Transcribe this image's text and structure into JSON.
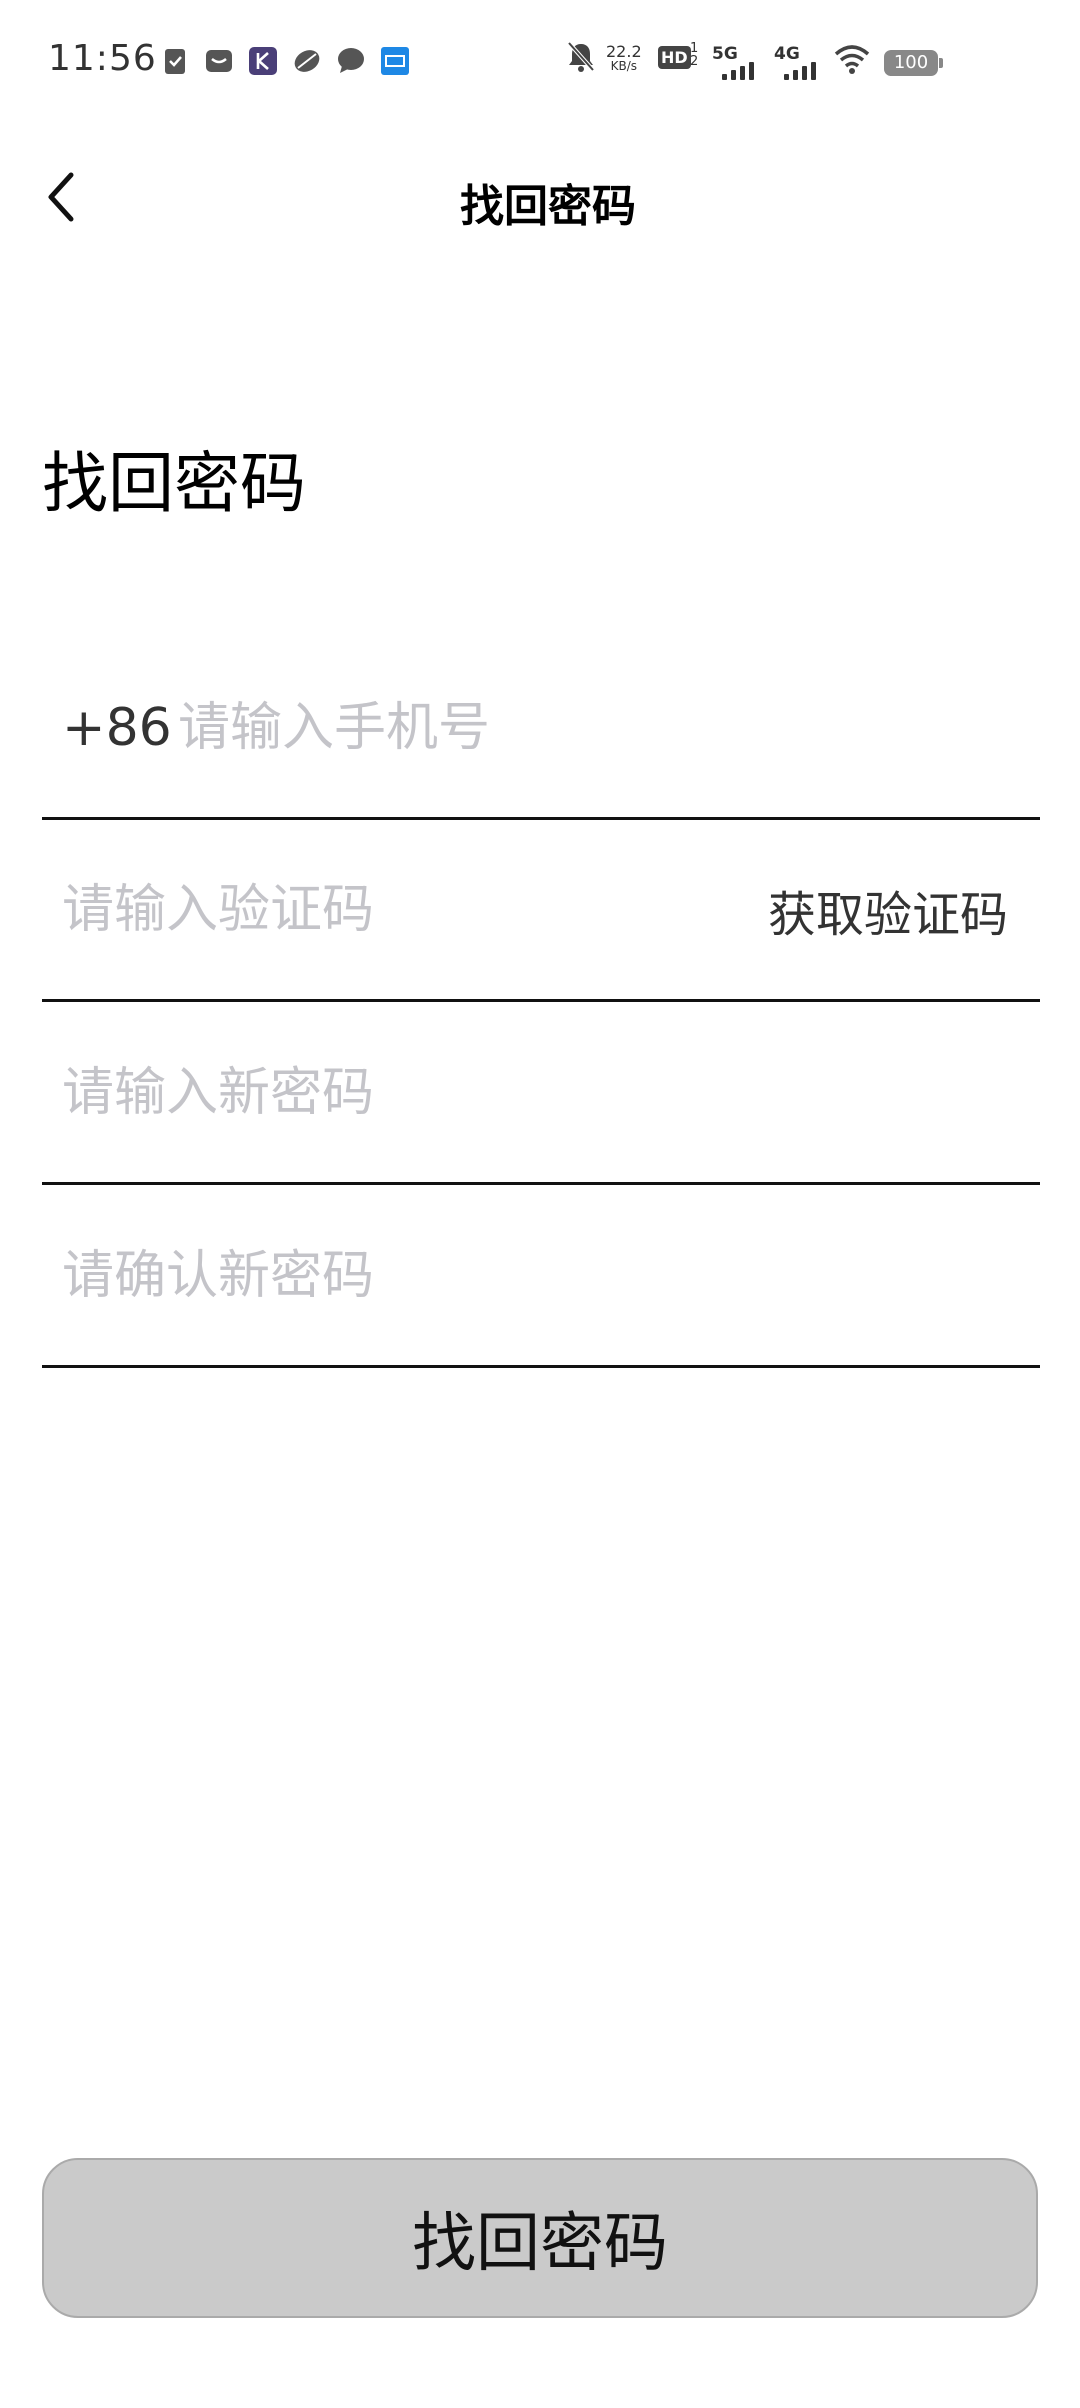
{
  "status_bar": {
    "time": "11:56",
    "net_speed_value": "22.2",
    "net_speed_unit": "KB/s",
    "hd_label": "HD",
    "sim_label": "5G",
    "sim2_label": "4G",
    "battery": "100",
    "app_icons": [
      "task-icon",
      "mail-icon",
      "k-app-icon",
      "sport-app-icon",
      "chat-icon",
      "blue-app-icon"
    ]
  },
  "header": {
    "title": "找回密码"
  },
  "heading": "找回密码",
  "form": {
    "phone": {
      "prefix": "+86",
      "placeholder": "请输入手机号"
    },
    "code": {
      "placeholder": "请输入验证码",
      "action": "获取验证码"
    },
    "new_password": {
      "placeholder": "请输入新密码"
    },
    "confirm_password": {
      "placeholder": "请确认新密码"
    }
  },
  "submit": {
    "label": "找回密码"
  },
  "colors": {
    "button_bg": "#cacaca",
    "placeholder": "#c4c4c9",
    "line": "#111111"
  }
}
